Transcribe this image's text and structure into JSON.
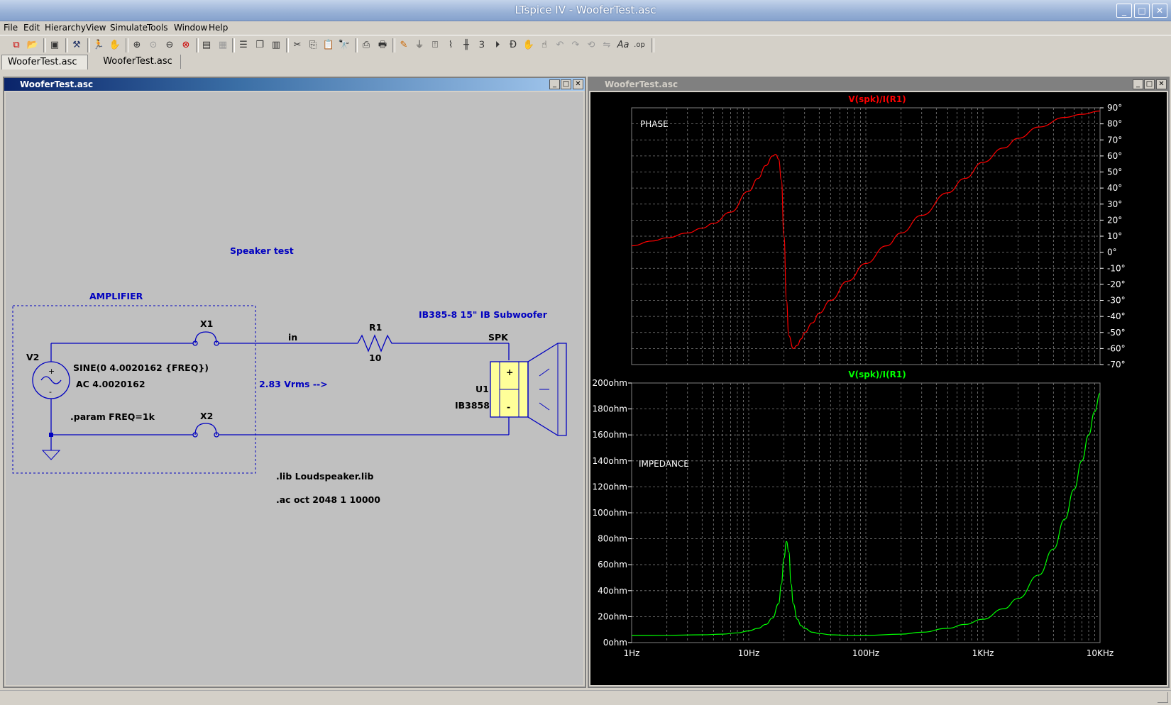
{
  "app": {
    "title": "LTspice IV - WooferTest.asc",
    "window_controls": [
      "minimize-icon",
      "maximize-icon",
      "close-icon"
    ]
  },
  "menu": [
    "File",
    "Edit",
    "Hierarchy",
    "View",
    "Simulate",
    "Tools",
    "Window",
    "Help"
  ],
  "toolbar_icons": [
    "new-schematic-icon",
    "open-icon",
    "save-icon",
    "control-panel-icon",
    "run-icon",
    "halt-icon",
    "zoom-in-icon",
    "pan-icon",
    "zoom-out-icon",
    "zoom-fit-icon",
    "autorange-icon",
    "grid-icon",
    "tile-horizontal-icon",
    "cascade-icon",
    "tile-vertical-icon",
    "cut-icon",
    "copy-icon",
    "paste-icon",
    "find-icon",
    "print-setup-icon",
    "print-icon",
    "wire-icon",
    "ground-icon",
    "label-net-icon",
    "resistor-icon",
    "capacitor-icon",
    "inductor-icon",
    "diode-icon",
    "component-icon",
    "move-icon",
    "drag-icon",
    "undo-icon",
    "redo-icon",
    "rotate-icon",
    "mirror-icon",
    "text-icon",
    "spice-directive-icon"
  ],
  "tabs": [
    {
      "label": "WooferTest.asc",
      "active": true
    },
    {
      "label": "WooferTest.asc",
      "active": false
    }
  ],
  "schematic": {
    "window_title": "WooferTest.asc",
    "title_text": "Speaker test",
    "amplifier_label": "AMPLIFIER",
    "source_name": "V2",
    "source_line1": "SINE(0 4.0020162 {FREQ})",
    "source_line2": "AC 4.0020162",
    "param": ".param FREQ=1k",
    "x1": "X1",
    "x2": "X2",
    "net_in": "in",
    "r1_name": "R1",
    "r1_value": "10",
    "vrms": "2.83 Vrms -->",
    "speaker_desc": "IB385-8 15\" IB Subwoofer",
    "net_spk": "SPK",
    "u1_name": "U1",
    "u1_model": "IB3858",
    "plus": "+",
    "minus": "-",
    "lib": ".lib Loudspeaker.lib",
    "ac": ".ac oct 2048 1 10000",
    "colors": {
      "wire": "#0000c0",
      "text": "#000000",
      "label": "#0000c0",
      "bg": "#c0c0c0",
      "speaker_fill": "#ffff99"
    }
  },
  "plot": {
    "window_title": "WooferTest.asc",
    "colors": {
      "bg": "#000000",
      "phase": "#ff0000",
      "impedance": "#00ff00",
      "grid": "#808080",
      "text": "#ffffff"
    }
  },
  "chart_data": [
    {
      "type": "line",
      "title": "V(spk)/I(R1)",
      "annotation": "PHASE",
      "xscale": "log",
      "xlim": [
        1,
        10000
      ],
      "ylim": [
        -70,
        90
      ],
      "x_ticks": [
        "1Hz",
        "10Hz",
        "100Hz",
        "1KHz",
        "10KHz"
      ],
      "y_ticks": [
        "90°",
        "80°",
        "70°",
        "60°",
        "50°",
        "40°",
        "30°",
        "20°",
        "10°",
        "0°",
        "-10°",
        "-20°",
        "-30°",
        "-40°",
        "-50°",
        "-60°",
        "-70°"
      ],
      "series": [
        {
          "name": "V(spk)/I(R1)",
          "color": "#ff0000",
          "x": [
            1,
            1.5,
            2,
            3,
            4,
            5,
            7,
            10,
            12,
            14,
            16,
            17,
            18,
            19,
            20,
            21,
            22,
            24,
            26,
            28,
            30,
            35,
            40,
            50,
            70,
            100,
            150,
            200,
            300,
            500,
            700,
            1000,
            1500,
            2000,
            3000,
            5000,
            7000,
            10000
          ],
          "y": [
            4,
            7,
            9,
            12,
            15,
            18,
            25,
            38,
            46,
            54,
            60,
            61,
            58,
            45,
            10,
            -30,
            -52,
            -60,
            -58,
            -54,
            -50,
            -44,
            -38,
            -30,
            -18,
            -7,
            4,
            12,
            23,
            37,
            46,
            56,
            65,
            71,
            78,
            84,
            86,
            88
          ]
        }
      ]
    },
    {
      "type": "line",
      "title": "V(spk)/I(R1)",
      "annotation": "IMPEDANCE",
      "xscale": "log",
      "xlim": [
        1,
        10000
      ],
      "ylim": [
        0,
        200
      ],
      "x_ticks": [
        "1Hz",
        "10Hz",
        "100Hz",
        "1KHz",
        "10KHz"
      ],
      "y_ticks": [
        "200ohm",
        "180ohm",
        "160ohm",
        "140ohm",
        "120ohm",
        "100ohm",
        "80ohm",
        "60ohm",
        "40ohm",
        "20ohm",
        "0ohm"
      ],
      "series": [
        {
          "name": "V(spk)/I(R1)",
          "color": "#00ff00",
          "x": [
            1,
            2,
            4,
            6,
            8,
            10,
            12,
            14,
            16,
            18,
            19,
            20,
            21,
            22,
            23,
            24,
            26,
            28,
            30,
            35,
            40,
            50,
            70,
            100,
            200,
            300,
            500,
            700,
            1000,
            1500,
            2000,
            3000,
            4000,
            5000,
            6000,
            7000,
            8000,
            9000,
            10000
          ],
          "y": [
            5.5,
            5.6,
            6,
            6.5,
            7.5,
            9,
            11,
            14,
            19,
            30,
            45,
            65,
            78,
            70,
            45,
            30,
            18,
            13,
            11,
            8,
            7,
            6,
            5.6,
            5.5,
            6.5,
            8,
            11,
            14,
            18,
            26,
            34,
            52,
            72,
            95,
            118,
            140,
            160,
            178,
            192
          ]
        }
      ]
    }
  ]
}
